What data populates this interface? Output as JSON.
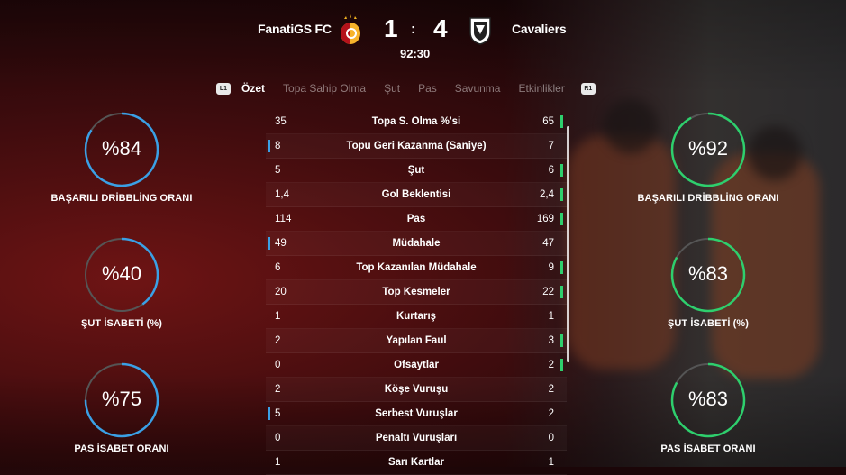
{
  "header": {
    "home_team": "FanatiGS FC",
    "away_team": "Cavaliers",
    "home_score": "1",
    "away_score": "4",
    "separator": ":",
    "clock": "92:30"
  },
  "tabs": {
    "left_hint": "L1",
    "right_hint": "R1",
    "items": [
      "Özet",
      "Topa Sahip Olma",
      "Şut",
      "Pas",
      "Savunma",
      "Etkinlikler"
    ],
    "active": "Özet"
  },
  "colors": {
    "home_accent": "#3aa0e6",
    "away_accent": "#2ecf6d",
    "ring_track": "#555555"
  },
  "home_circles": [
    {
      "value": "%84",
      "percent": 84,
      "label": "BAŞARILI DRİBBLİNG ORANI"
    },
    {
      "value": "%40",
      "percent": 40,
      "label": "ŞUT İSABETİ (%)"
    },
    {
      "value": "%75",
      "percent": 75,
      "label": "PAS İSABET ORANI"
    }
  ],
  "away_circles": [
    {
      "value": "%92",
      "percent": 92,
      "label": "BAŞARILI DRİBBLİNG ORANI"
    },
    {
      "value": "%83",
      "percent": 83,
      "label": "ŞUT İSABETİ (%)"
    },
    {
      "value": "%83",
      "percent": 83,
      "label": "PAS İSABET ORANI"
    }
  ],
  "stats": [
    {
      "home": "35",
      "label": "Topa S. Olma %'si",
      "away": "65",
      "leader": "away"
    },
    {
      "home": "8",
      "label": "Topu Geri Kazanma (Saniye)",
      "away": "7",
      "leader": "home"
    },
    {
      "home": "5",
      "label": "Şut",
      "away": "6",
      "leader": "away"
    },
    {
      "home": "1,4",
      "label": "Gol Beklentisi",
      "away": "2,4",
      "leader": "away"
    },
    {
      "home": "114",
      "label": "Pas",
      "away": "169",
      "leader": "away"
    },
    {
      "home": "49",
      "label": "Müdahale",
      "away": "47",
      "leader": "home"
    },
    {
      "home": "6",
      "label": "Top Kazanılan Müdahale",
      "away": "9",
      "leader": "away"
    },
    {
      "home": "20",
      "label": "Top Kesmeler",
      "away": "22",
      "leader": "away"
    },
    {
      "home": "1",
      "label": "Kurtarış",
      "away": "1",
      "leader": "none"
    },
    {
      "home": "2",
      "label": "Yapılan Faul",
      "away": "3",
      "leader": "away"
    },
    {
      "home": "0",
      "label": "Ofsaytlar",
      "away": "2",
      "leader": "away"
    },
    {
      "home": "2",
      "label": "Köşe Vuruşu",
      "away": "2",
      "leader": "none"
    },
    {
      "home": "5",
      "label": "Serbest Vuruşlar",
      "away": "2",
      "leader": "home"
    },
    {
      "home": "0",
      "label": "Penaltı Vuruşları",
      "away": "0",
      "leader": "none"
    },
    {
      "home": "1",
      "label": "Sarı Kartlar",
      "away": "1",
      "leader": "none"
    }
  ]
}
